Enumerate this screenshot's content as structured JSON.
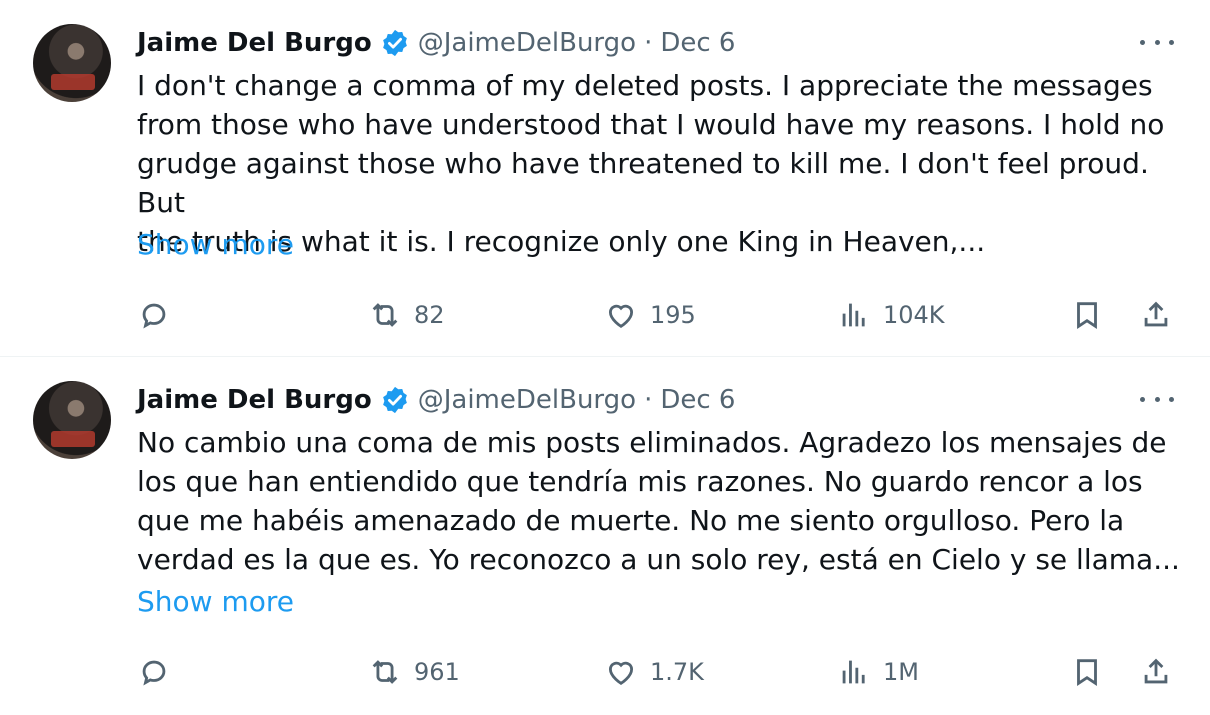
{
  "tweets": [
    {
      "author_name": "Jaime Del Burgo",
      "handle": "@JaimeDelBurgo",
      "separator": "·",
      "date": "Dec 6",
      "text": "I don't change a comma of my deleted posts. I appreciate the messages\nfrom those who have understood that I would have my reasons. I hold no\ngrudge against those who have threatened to kill me. I don't feel proud. But\nthe truth is what it is. I recognize only one King in Heaven,...",
      "show_more": "Show more",
      "retweets": "82",
      "likes": "195",
      "views": "104K"
    },
    {
      "author_name": "Jaime Del Burgo",
      "handle": "@JaimeDelBurgo",
      "separator": "·",
      "date": "Dec 6",
      "text": "No cambio una coma de mis posts eliminados. Agradezo los mensajes de\nlos que han entiendido que tendría mis razones. No guardo rencor a los\nque me habéis amenazado de muerte. No me siento orgulloso. Pero la\nverdad es la que es. Yo reconozco a un solo rey, está en Cielo y se llama...",
      "show_more": "Show more",
      "retweets": "961",
      "likes": "1.7K",
      "views": "1M"
    }
  ],
  "colors": {
    "accent": "#1d9bf0",
    "muted": "#536471",
    "text": "#0f1419"
  },
  "icons": [
    "verified-badge-icon",
    "more-icon",
    "reply-icon",
    "retweet-icon",
    "like-icon",
    "views-icon",
    "bookmark-icon",
    "share-icon"
  ]
}
